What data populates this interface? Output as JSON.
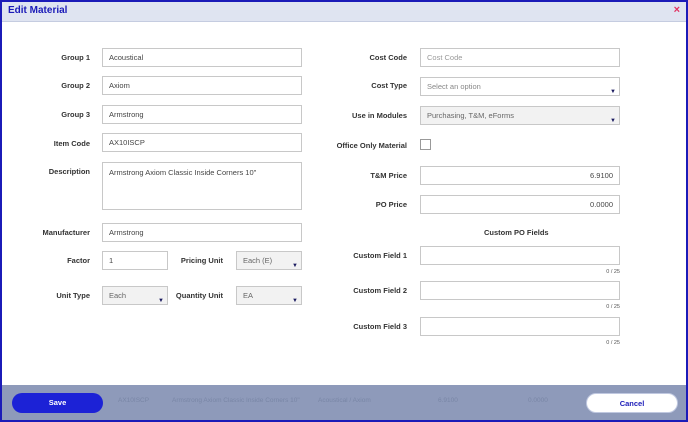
{
  "dialog": {
    "title": "Edit Material",
    "close_icon": "×"
  },
  "left": {
    "group1": {
      "label": "Group 1",
      "value": "Acoustical"
    },
    "group2": {
      "label": "Group 2",
      "value": "Axiom"
    },
    "group3": {
      "label": "Group 3",
      "value": "Armstrong"
    },
    "item_code": {
      "label": "Item Code",
      "value": "AX10ISCP"
    },
    "description": {
      "label": "Description",
      "value": "Armstrong Axiom Classic  Inside Corners 10\""
    },
    "manufacturer": {
      "label": "Manufacturer",
      "value": "Armstrong"
    },
    "factor": {
      "label": "Factor",
      "value": "1"
    },
    "pricing_unit": {
      "label": "Pricing Unit",
      "value": "Each (E)"
    },
    "unit_type": {
      "label": "Unit Type",
      "value": "Each"
    },
    "quantity_unit": {
      "label": "Quantity Unit",
      "value": "EA"
    }
  },
  "right": {
    "cost_code": {
      "label": "Cost Code",
      "placeholder": "Cost Code"
    },
    "cost_type": {
      "label": "Cost Type",
      "value": "Select an option"
    },
    "use_in_modules": {
      "label": "Use in Modules",
      "value": "Purchasing, T&M, eForms"
    },
    "office_only": {
      "label": "Office Only Material",
      "checked": false
    },
    "tm_price": {
      "label": "T&M Price",
      "value": "6.9100"
    },
    "po_price": {
      "label": "PO Price",
      "value": "0.0000"
    },
    "custom_po_fields": {
      "heading": "Custom PO Fields",
      "fields": [
        {
          "label": "Custom Field 1",
          "value": "",
          "counter": "0 / 25"
        },
        {
          "label": "Custom Field 2",
          "value": "",
          "counter": "0 / 25"
        },
        {
          "label": "Custom Field 3",
          "value": "",
          "counter": "0 / 25"
        }
      ]
    }
  },
  "footer": {
    "save_label": "Save",
    "cancel_label": "Cancel",
    "background_text": [
      "AX10ISCP",
      "Armstrong Axiom Classic Inside Corners 10\"",
      "Acoustical / Axiom",
      "6.9100",
      "0.0000"
    ]
  },
  "colors": {
    "accent": "#1b1bb8",
    "save_button": "#1c22d6",
    "close": "#e03060",
    "footer": "#8e9aba"
  },
  "icons": {
    "dropdown": "chevron-down-icon",
    "close": "close-icon"
  }
}
